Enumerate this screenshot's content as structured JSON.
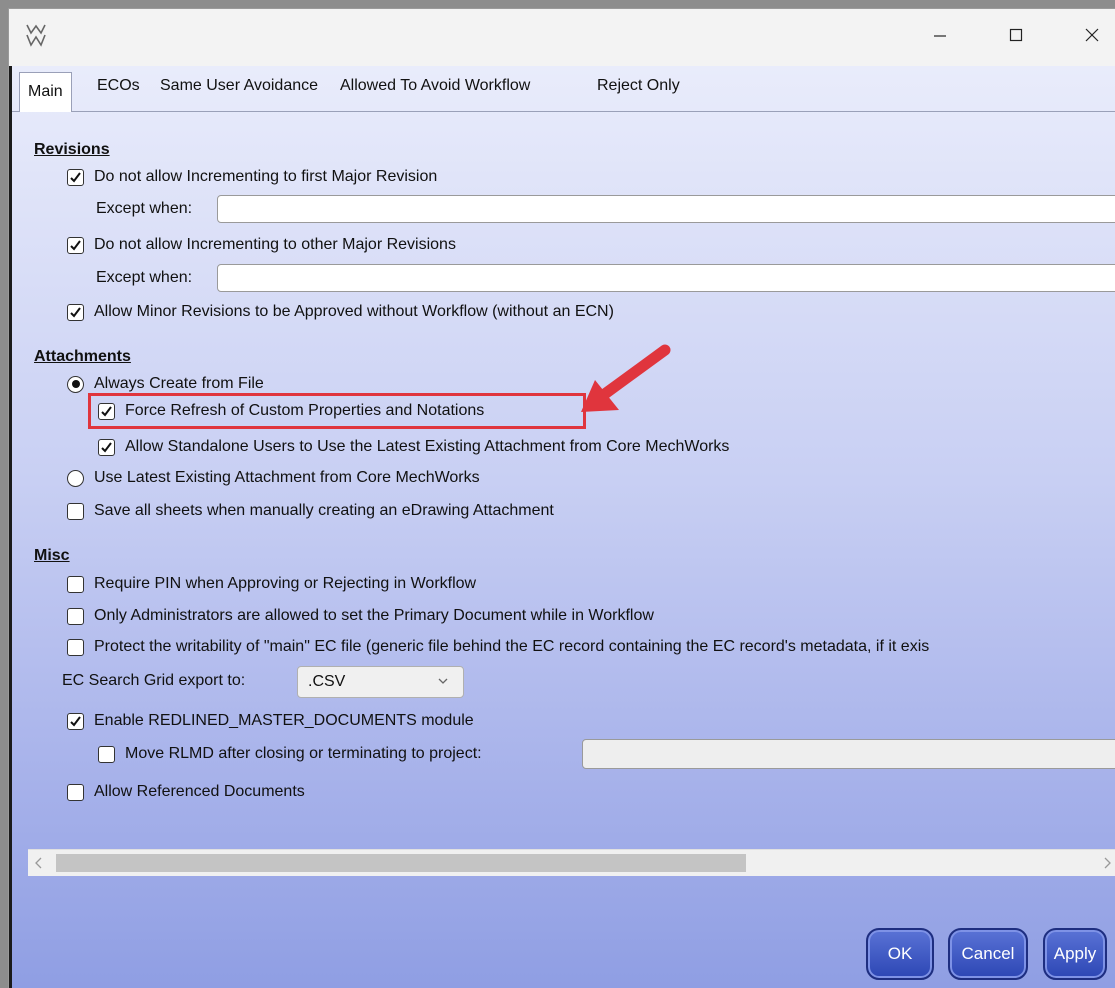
{
  "window": {
    "title": "",
    "controls": {
      "minimize": "minimize-icon",
      "maximize": "maximize-icon",
      "close": "close-icon"
    }
  },
  "tabs": [
    {
      "label": "Main",
      "active": true
    },
    {
      "label": "ECOs"
    },
    {
      "label": "Same User Avoidance"
    },
    {
      "label": "Allowed To Avoid Workflow"
    },
    {
      "label": "Reject Only"
    }
  ],
  "revisions": {
    "heading": "Revisions",
    "first_major": {
      "label": "Do not allow Incrementing to first Major Revision",
      "checked": true
    },
    "first_major_except": {
      "label": "Except when:",
      "value": ""
    },
    "other_major": {
      "label": "Do not allow Incrementing to other Major Revisions",
      "checked": true
    },
    "other_major_except": {
      "label": "Except when:",
      "value": ""
    },
    "minor": {
      "label": "Allow Minor Revisions to be Approved without Workflow (without an ECN)",
      "checked": true
    }
  },
  "attachments": {
    "heading": "Attachments",
    "always_create": {
      "label": "Always Create from File",
      "selected": true
    },
    "force_refresh": {
      "label": "Force Refresh of Custom Properties and Notations",
      "checked": true
    },
    "allow_standalone": {
      "label": "Allow Standalone Users to Use the Latest Existing Attachment from Core MechWorks",
      "checked": true
    },
    "use_latest": {
      "label": "Use Latest Existing Attachment from Core MechWorks",
      "selected": false
    },
    "save_sheets": {
      "label": "Save all sheets when manually creating an eDrawing Attachment",
      "checked": false
    }
  },
  "misc": {
    "heading": "Misc",
    "require_pin": {
      "label": "Require PIN when Approving or Rejecting in Workflow",
      "checked": false
    },
    "only_admins": {
      "label": "Only Administrators are allowed to set the Primary Document while in Workflow",
      "checked": false
    },
    "protect_main": {
      "label": "Protect the writability of \"main\" EC file (generic file behind the EC record containing the EC record's metadata, if it exis",
      "checked": false
    },
    "export_label": "EC Search Grid export to:",
    "export_value": ".CSV",
    "enable_rlmd": {
      "label": "Enable REDLINED_MASTER_DOCUMENTS module",
      "checked": true
    },
    "move_rlmd": {
      "label": "Move RLMD after closing or terminating to project:",
      "checked": false,
      "value": ""
    },
    "allow_referenced": {
      "label": "Allow Referenced Documents",
      "checked": false
    }
  },
  "buttons": {
    "ok": "OK",
    "cancel": "Cancel",
    "apply": "Apply"
  },
  "colors": {
    "highlight": "#e0353d",
    "button": "#3650c4"
  }
}
